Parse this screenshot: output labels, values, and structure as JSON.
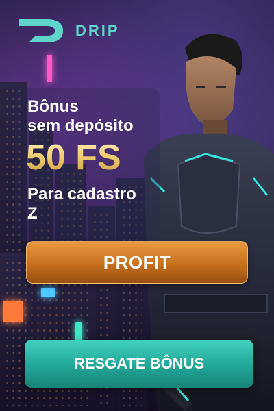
{
  "brand": {
    "name": "DRIP",
    "logo_color": "#5fd4c8"
  },
  "promo": {
    "line1": "Bônus",
    "line2": "sem depósito",
    "amount": "50 FS",
    "line3": "Para cadastro",
    "line4": "Z"
  },
  "code": {
    "value": "PROFIT",
    "color": "#d27a26"
  },
  "cta": {
    "label": "RESGATE BÔNUS",
    "color": "#2bb5a5"
  },
  "hero": {
    "icon": "cyberpunk-warrior-illustration"
  }
}
